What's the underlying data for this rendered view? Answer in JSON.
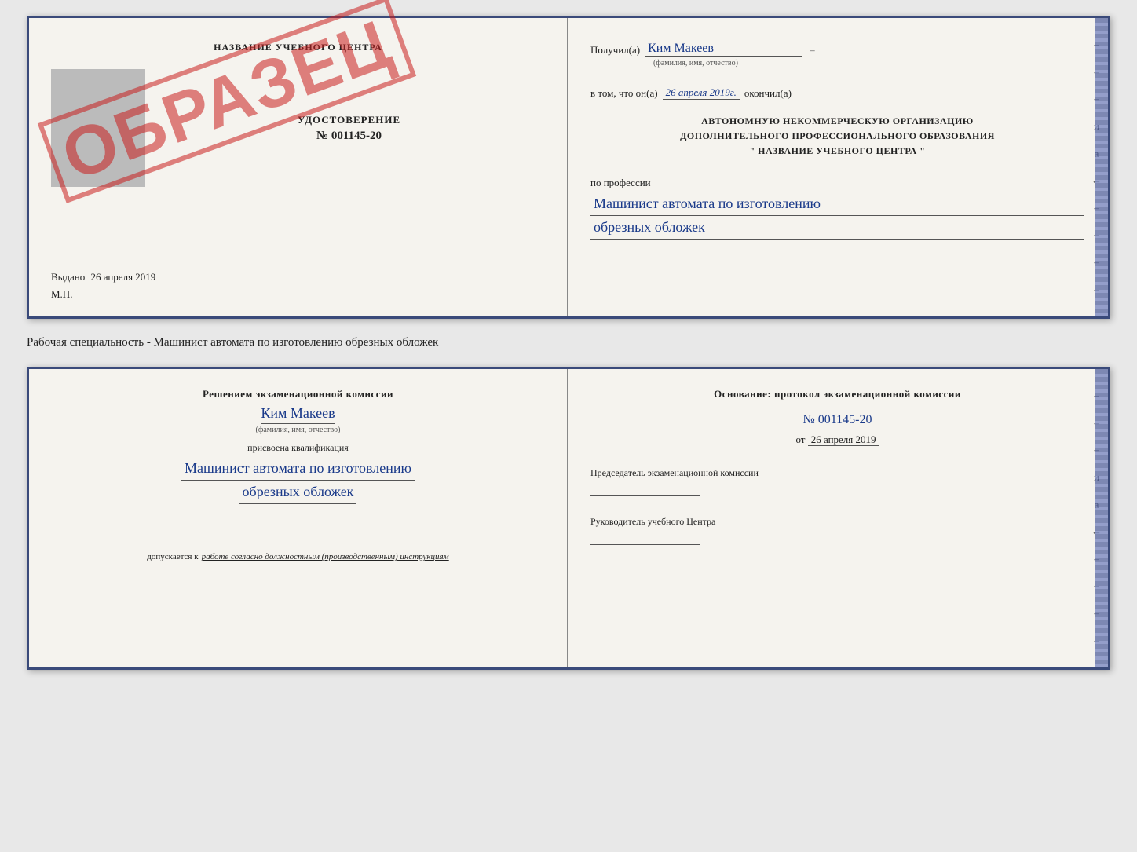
{
  "top_document": {
    "left": {
      "school_name": "НАЗВАНИЕ УЧЕБНОГО ЦЕНТРА",
      "stamp_text": "ОБРАЗЕЦ",
      "udostoverenie_title": "УДОСТОВЕРЕНИЕ",
      "udostoverenie_number": "№ 001145-20",
      "vydano_label": "Выдано",
      "vydano_date": "26 апреля 2019",
      "mp_label": "М.П."
    },
    "right": {
      "poluchil_label": "Получил(а)",
      "poluchil_value": "Ким Макеев",
      "fio_subtitle": "(фамилия, имя, отчество)",
      "vtom_label": "в том, что он(а)",
      "vtom_value": "26 апреля 2019г.",
      "okonchil_label": "окончил(а)",
      "org_line1": "АВТОНОМНУЮ НЕКОММЕРЧЕСКУЮ ОРГАНИЗАЦИЮ",
      "org_line2": "ДОПОЛНИТЕЛЬНОГО ПРОФЕССИОНАЛЬНОГО ОБРАЗОВАНИЯ",
      "org_line3": "\"  НАЗВАНИЕ УЧЕБНОГО ЦЕНТРА  \"",
      "po_professii": "по профессии",
      "professiya_line1": "Машинист автомата по изготовлению",
      "professiya_line2": "обрезных обложек",
      "side_dashes": [
        "-",
        "-",
        "-",
        "и",
        "а",
        "←",
        "-",
        "-",
        "-",
        "-"
      ]
    }
  },
  "caption": {
    "text": "Рабочая специальность - Машинист автомата по изготовлению обрезных обложек"
  },
  "bottom_document": {
    "left": {
      "resheniem_label": "Решением экзаменационной комиссии",
      "name_value": "Ким Макеев",
      "fio_subtitle": "(фамилия, имя, отчество)",
      "prisvoena_label": "присвоена квалификация",
      "kvalifikatsiya_line1": "Машинист автомата по изготовлению",
      "kvalifikatsiya_line2": "обрезных обложек",
      "dopuskaetsya_label": "допускается к",
      "dopuskaetsya_value": "работе согласно должностным (производственным) инструкциям"
    },
    "right": {
      "osnovanie_label": "Основание: протокол экзаменационной комиссии",
      "number_label": "№ 001145-20",
      "ot_label": "от",
      "ot_date": "26 апреля 2019",
      "predsedatel_label": "Председатель экзаменационной комиссии",
      "rukovoditel_label": "Руководитель учебного Центра",
      "side_dashes": [
        "-",
        "-",
        "-",
        "и",
        "а",
        "←",
        "-",
        "-",
        "-",
        "-"
      ]
    }
  }
}
